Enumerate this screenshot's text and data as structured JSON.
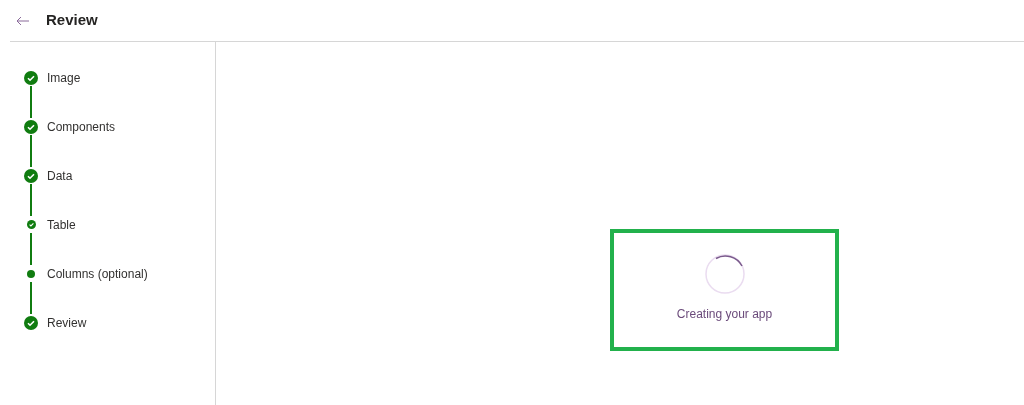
{
  "header": {
    "title": "Review"
  },
  "steps": [
    {
      "label": "Image",
      "kind": "done"
    },
    {
      "label": "Components",
      "kind": "done"
    },
    {
      "label": "Data",
      "kind": "done"
    },
    {
      "label": "Table",
      "kind": "small-check"
    },
    {
      "label": "Columns (optional)",
      "kind": "dot"
    },
    {
      "label": "Review",
      "kind": "done"
    }
  ],
  "status": {
    "message": "Creating your app",
    "highlighted": true
  }
}
